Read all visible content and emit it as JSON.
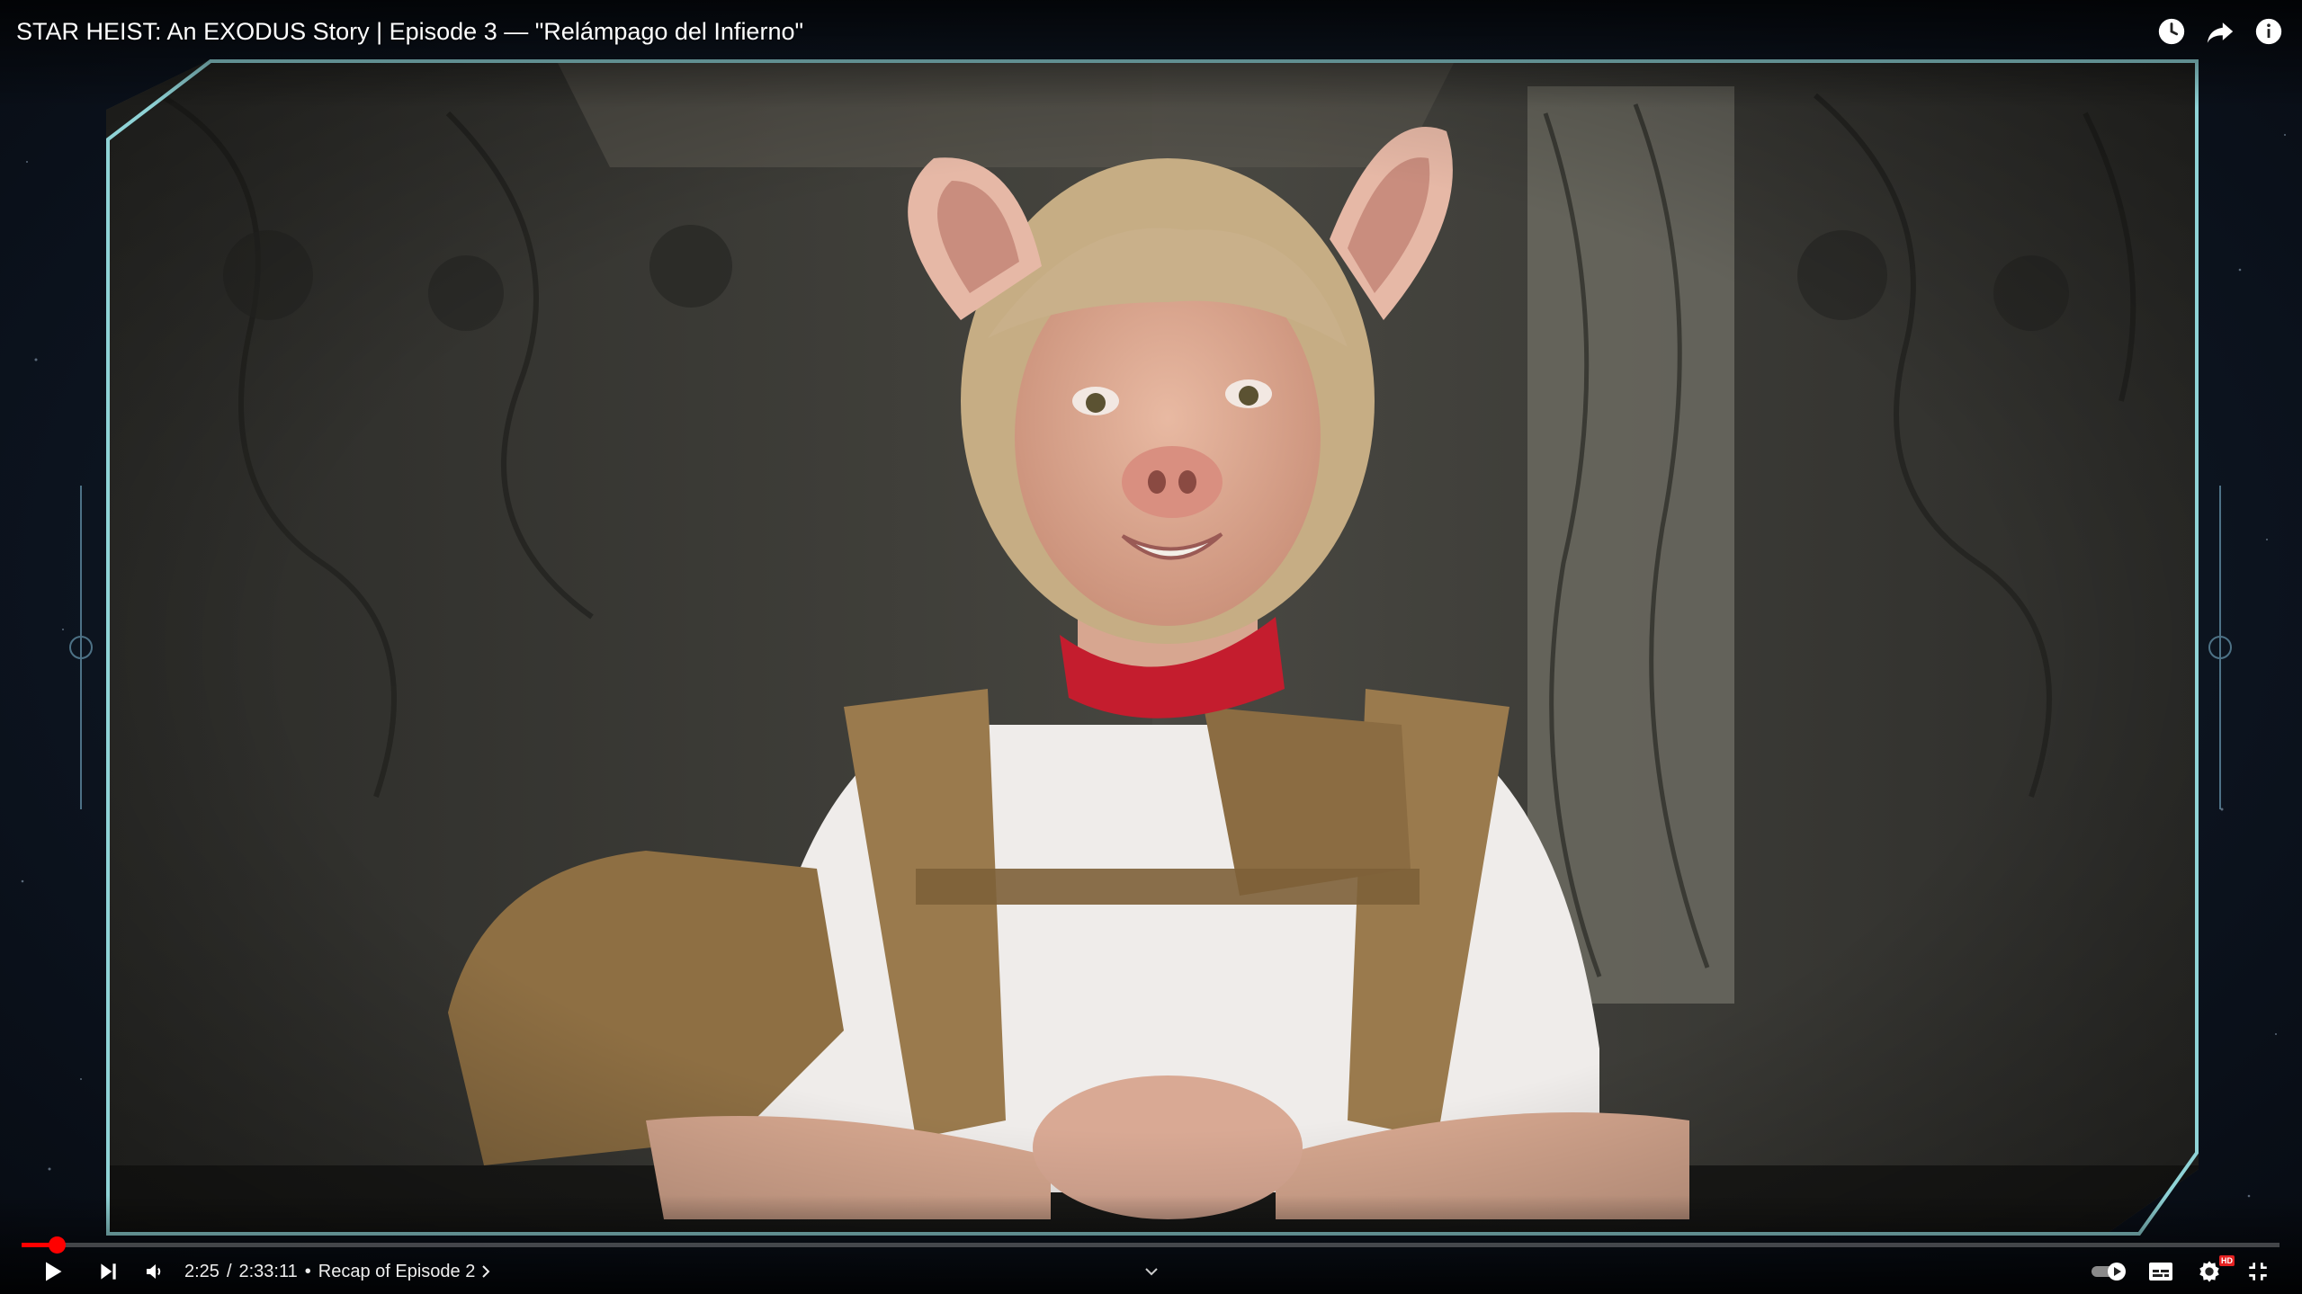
{
  "video": {
    "title": "STAR HEIST: An EXODUS Story | Episode 3 — \"Relámpago del Infierno\"",
    "current_time": "2:25",
    "duration": "2:33:11",
    "time_separator": "/",
    "chapter_separator": "•",
    "chapter": "Recap of Episode 2",
    "progress_fraction": 0.0157
  },
  "top_actions": [
    {
      "name": "watch-later",
      "icon": "clock-icon"
    },
    {
      "name": "share",
      "icon": "share-arrow-icon"
    },
    {
      "name": "info",
      "icon": "info-icon"
    }
  ],
  "controls": {
    "left": [
      "play-icon",
      "next-icon",
      "volume-icon"
    ],
    "right": [
      "autoplay-toggle-icon",
      "subtitles-icon",
      "settings-gear-icon",
      "exit-fullscreen-icon"
    ],
    "hd_badge": "HD"
  },
  "colors": {
    "accent": "#ff0000",
    "frame": "#8fd3d6"
  }
}
